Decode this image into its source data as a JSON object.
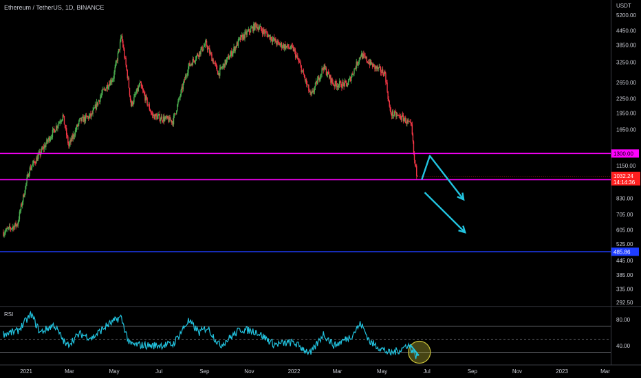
{
  "header": {
    "symbol": "Ethereum / TetherUS, 1D, BINANCE",
    "unit": "USDT"
  },
  "rsi_panel": {
    "label": "RSI"
  },
  "colors": {
    "background": "#000000",
    "up_candle": "#4caf50",
    "down_candle": "#f23645",
    "level_line": "#ff00ff",
    "support_line": "#1e3dff",
    "rsi_line": "#22c4e0",
    "arrow": "#22c4e0",
    "circle_fill": "#c9c23a",
    "price_tag": "#ff1f1f"
  },
  "chart_data": [
    {
      "type": "candlestick",
      "scale": "log",
      "x_start": "2020-12-01",
      "x_ticks": [
        {
          "date": "2021-01-01",
          "label": "2021"
        },
        {
          "date": "2021-03-01",
          "label": "Mar"
        },
        {
          "date": "2021-05-01",
          "label": "May"
        },
        {
          "date": "2021-07-01",
          "label": "Jul"
        },
        {
          "date": "2021-09-01",
          "label": "Sep"
        },
        {
          "date": "2021-11-01",
          "label": "Nov"
        },
        {
          "date": "2022-01-01",
          "label": "2022"
        },
        {
          "date": "2022-03-01",
          "label": "Mar"
        },
        {
          "date": "2022-05-01",
          "label": "May"
        },
        {
          "date": "2022-07-01",
          "label": "Jul"
        },
        {
          "date": "2022-09-01",
          "label": "Sep"
        },
        {
          "date": "2022-11-01",
          "label": "Nov"
        },
        {
          "date": "2023-01-01",
          "label": "2023"
        },
        {
          "date": "2023-03-01",
          "label": "Mar"
        }
      ],
      "y_ticks": [
        5200,
        4450,
        3850,
        3250,
        2650,
        2250,
        1950,
        1650,
        1150,
        830,
        705,
        605,
        525,
        445,
        385,
        335,
        292.5
      ],
      "y_tick_labels": [
        "5200.00",
        "4450.00",
        "3850.00",
        "3250.00",
        "2650.00",
        "2250.00",
        "1950.00",
        "1650.00",
        "1150.00",
        "830.00",
        "705.00",
        "605.00",
        "525.00",
        "445.00",
        "385.00",
        "335.00",
        "292.50"
      ],
      "price_path": [
        {
          "date": "2020-12-01",
          "close": 590
        },
        {
          "date": "2020-12-20",
          "close": 640
        },
        {
          "date": "2021-01-05",
          "close": 1100
        },
        {
          "date": "2021-01-20",
          "close": 1300
        },
        {
          "date": "2021-02-06",
          "close": 1600
        },
        {
          "date": "2021-02-20",
          "close": 1900
        },
        {
          "date": "2021-02-28",
          "close": 1400
        },
        {
          "date": "2021-03-15",
          "close": 1800
        },
        {
          "date": "2021-03-31",
          "close": 1900
        },
        {
          "date": "2021-04-15",
          "close": 2400
        },
        {
          "date": "2021-04-30",
          "close": 2800
        },
        {
          "date": "2021-05-11",
          "close": 4200
        },
        {
          "date": "2021-05-20",
          "close": 2700
        },
        {
          "date": "2021-05-24",
          "close": 2100
        },
        {
          "date": "2021-06-05",
          "close": 2600
        },
        {
          "date": "2021-06-22",
          "close": 1900
        },
        {
          "date": "2021-07-20",
          "close": 1800
        },
        {
          "date": "2021-08-10",
          "close": 3100
        },
        {
          "date": "2021-09-03",
          "close": 3900
        },
        {
          "date": "2021-09-20",
          "close": 2900
        },
        {
          "date": "2021-10-20",
          "close": 4100
        },
        {
          "date": "2021-11-10",
          "close": 4700
        },
        {
          "date": "2021-11-25",
          "close": 4300
        },
        {
          "date": "2021-12-10",
          "close": 3900
        },
        {
          "date": "2021-12-31",
          "close": 3700
        },
        {
          "date": "2022-01-10",
          "close": 3100
        },
        {
          "date": "2022-01-24",
          "close": 2300
        },
        {
          "date": "2022-02-10",
          "close": 3100
        },
        {
          "date": "2022-02-24",
          "close": 2600
        },
        {
          "date": "2022-03-15",
          "close": 2600
        },
        {
          "date": "2022-04-02",
          "close": 3500
        },
        {
          "date": "2022-04-20",
          "close": 3100
        },
        {
          "date": "2022-05-05",
          "close": 2900
        },
        {
          "date": "2022-05-12",
          "close": 1950
        },
        {
          "date": "2022-05-30",
          "close": 1850
        },
        {
          "date": "2022-06-10",
          "close": 1700
        },
        {
          "date": "2022-06-14",
          "close": 1200
        },
        {
          "date": "2022-06-18",
          "close": 1032.24
        }
      ],
      "horizontal_levels": [
        {
          "value": 1300,
          "label": "1300.00",
          "color": "#ff00ff"
        },
        {
          "value": 1000,
          "label": "1000.00",
          "color": "#ff00ff"
        },
        {
          "value": 485.86,
          "label": "485.86",
          "color": "#1e3dff"
        }
      ],
      "last_price": {
        "value": 1032.24,
        "label": "1032.24",
        "countdown": "14:14:36"
      },
      "annotations": [
        {
          "type": "arrow",
          "description": "zigzag projection",
          "points": [
            [
              "2022-06-24",
              1000
            ],
            [
              "2022-07-05",
              1270
            ],
            [
              "2022-08-20",
              820
            ]
          ]
        },
        {
          "type": "arrow",
          "description": "downward projection",
          "points": [
            [
              "2022-06-28",
              880
            ],
            [
              "2022-08-22",
              590
            ]
          ]
        }
      ]
    },
    {
      "type": "line",
      "name": "RSI",
      "y_ticks": [
        80,
        40
      ],
      "y_tick_labels": [
        "80.00",
        "40.00"
      ],
      "bands": [
        70,
        50,
        30
      ],
      "rsi_path": [
        {
          "date": "2020-12-01",
          "value": 58
        },
        {
          "date": "2020-12-20",
          "value": 62
        },
        {
          "date": "2021-01-08",
          "value": 88
        },
        {
          "date": "2021-01-20",
          "value": 60
        },
        {
          "date": "2021-02-08",
          "value": 72
        },
        {
          "date": "2021-02-25",
          "value": 40
        },
        {
          "date": "2021-03-15",
          "value": 58
        },
        {
          "date": "2021-04-01",
          "value": 52
        },
        {
          "date": "2021-04-20",
          "value": 70
        },
        {
          "date": "2021-05-10",
          "value": 84
        },
        {
          "date": "2021-05-22",
          "value": 42
        },
        {
          "date": "2021-06-20",
          "value": 40
        },
        {
          "date": "2021-07-20",
          "value": 42
        },
        {
          "date": "2021-08-10",
          "value": 78
        },
        {
          "date": "2021-08-25",
          "value": 60
        },
        {
          "date": "2021-09-05",
          "value": 68
        },
        {
          "date": "2021-09-22",
          "value": 40
        },
        {
          "date": "2021-10-20",
          "value": 65
        },
        {
          "date": "2021-11-10",
          "value": 62
        },
        {
          "date": "2021-12-05",
          "value": 42
        },
        {
          "date": "2021-12-31",
          "value": 45
        },
        {
          "date": "2022-01-24",
          "value": 28
        },
        {
          "date": "2022-02-10",
          "value": 58
        },
        {
          "date": "2022-02-25",
          "value": 40
        },
        {
          "date": "2022-03-20",
          "value": 55
        },
        {
          "date": "2022-04-02",
          "value": 74
        },
        {
          "date": "2022-04-15",
          "value": 45
        },
        {
          "date": "2022-05-12",
          "value": 28
        },
        {
          "date": "2022-05-28",
          "value": 35
        },
        {
          "date": "2022-06-05",
          "value": 42
        },
        {
          "date": "2022-06-18",
          "value": 22
        }
      ],
      "annotations": [
        {
          "type": "circle",
          "date": "2022-06-18",
          "value": 30
        },
        {
          "type": "arrow",
          "description": "RSI down arrow",
          "points": [
            [
              "2022-06-08",
              42
            ],
            [
              "2022-06-20",
              25
            ]
          ]
        }
      ]
    }
  ]
}
